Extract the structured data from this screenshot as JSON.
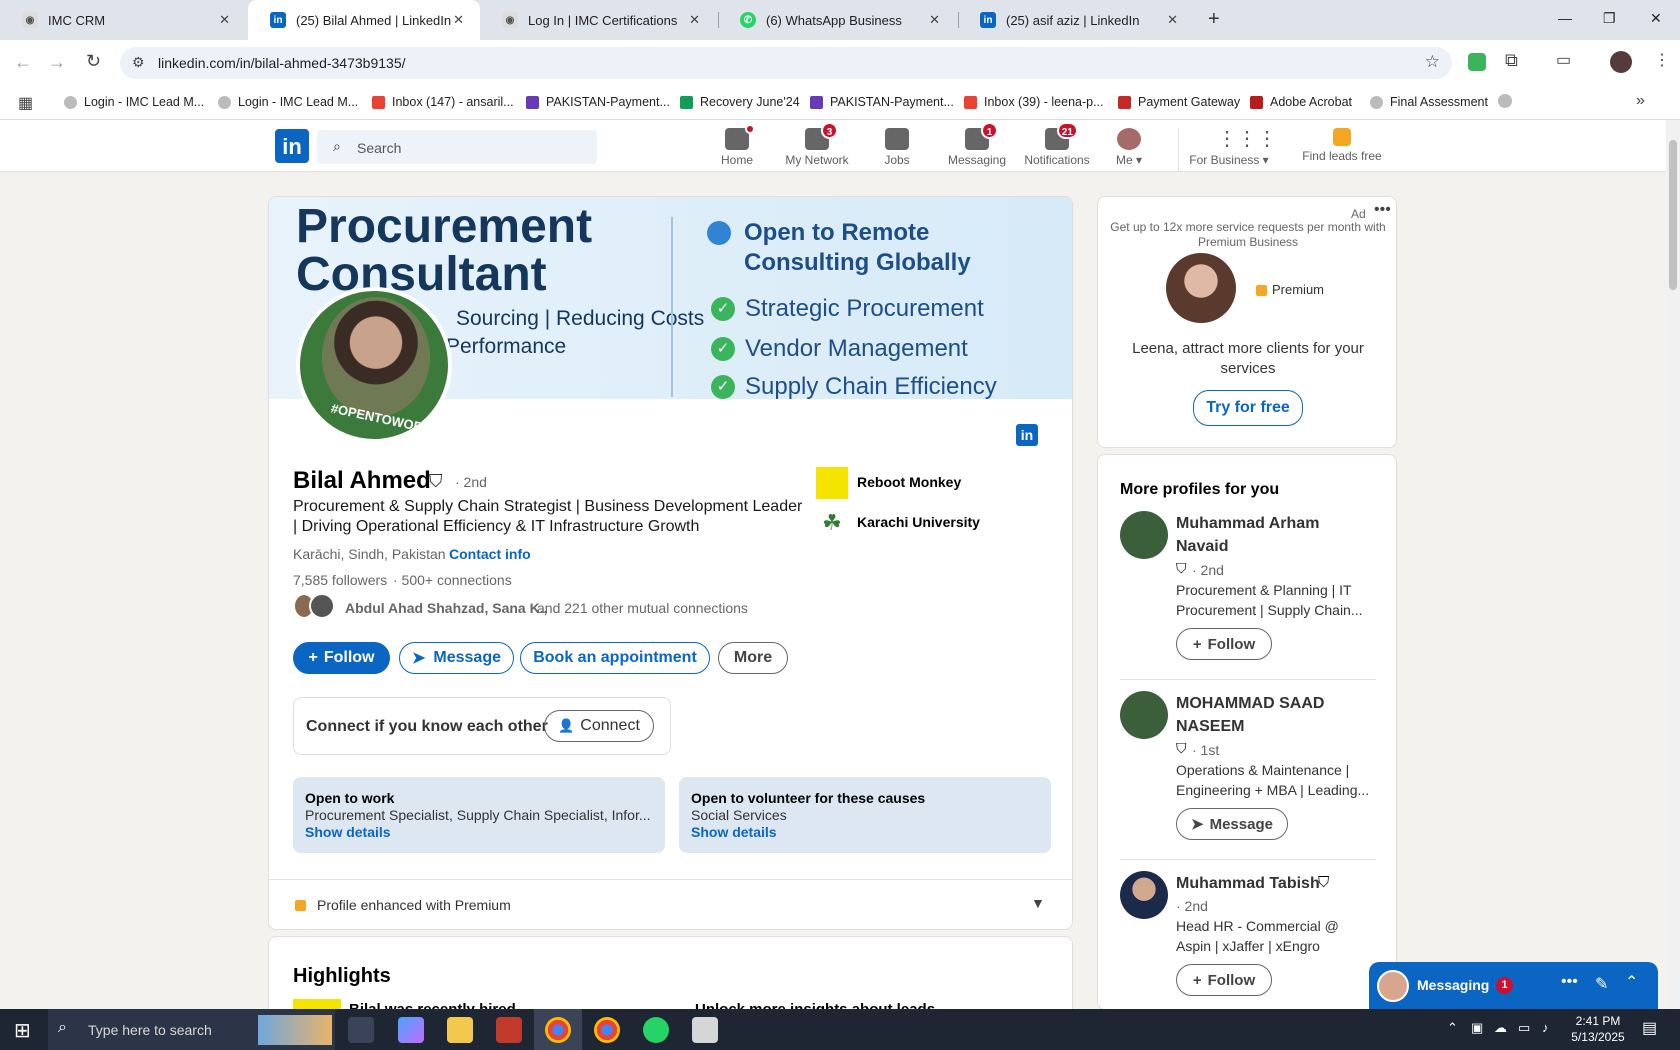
{
  "browser": {
    "tabs": [
      {
        "title": "IMC CRM",
        "icon": "imc-icon"
      },
      {
        "title": "(25) Bilal Ahmed | LinkedIn",
        "icon": "linkedin-icon"
      },
      {
        "title": "Log In | IMC Certifications",
        "icon": "imc-icon"
      },
      {
        "title": "(6) WhatsApp Business",
        "icon": "whatsapp-icon"
      },
      {
        "title": "(25) asif aziz | LinkedIn",
        "icon": "linkedin-icon"
      }
    ],
    "url": "linkedin.com/in/bilal-ahmed-3473b9135/",
    "bookmarks": [
      "Login - IMC Lead M...",
      "Login - IMC Lead M...",
      "Inbox (147) - ansaril...",
      "PAKISTAN-Payment...",
      "Recovery June'24",
      "PAKISTAN-Payment...",
      "Inbox (39) - leena-p...",
      "Payment Gateway",
      "Adobe Acrobat",
      "Final Assessment"
    ]
  },
  "linkedin_nav": {
    "search_placeholder": "Search",
    "items": [
      {
        "label": "Home",
        "badge": ""
      },
      {
        "label": "My Network",
        "badge": "3"
      },
      {
        "label": "Jobs",
        "badge": ""
      },
      {
        "label": "Messaging",
        "badge": "1"
      },
      {
        "label": "Notifications",
        "badge": "21"
      },
      {
        "label": "Me",
        "badge": ""
      },
      {
        "label": "For Business",
        "badge": ""
      },
      {
        "label": "Find leads free",
        "badge": ""
      }
    ]
  },
  "banner": {
    "title_line1": "Procurement",
    "title_line2": "Consultant",
    "sub_line1": "Sourcing | Reducing Costs",
    "sub_line2": "Performance",
    "right_head1": "Open to Remote",
    "right_head2": "Consulting Globally",
    "checks": [
      "Strategic Procurement",
      "Vendor Management",
      "Supply Chain Efficiency"
    ],
    "opentowork": "#OPENTOWORK"
  },
  "profile": {
    "name": "Bilal Ahmed",
    "degree": "· 2nd",
    "headline1": "Procurement & Supply Chain Strategist | Business Development Leader",
    "headline2": "| Driving Operational Efficiency & IT Infrastructure Growth",
    "location": "Karāchi, Sindh, Pakistan ·",
    "contact": "Contact info",
    "followers": "7,585 followers",
    "connections": "· 500+ connections",
    "mutual_names": "Abdul Ahad Shahzad, Sana K.,",
    "mutual_rest": "and 221 other mutual connections",
    "company": "Reboot Monkey",
    "school": "Karachi University",
    "follow": "Follow",
    "message": "Message",
    "book": "Book an appointment",
    "more": "More",
    "connect_text": "Connect if you know each other",
    "connect_btn": "Connect",
    "open_work_title": "Open to work",
    "open_work_desc": "Procurement Specialist, Supply Chain Specialist, Infor...",
    "open_work_link": "Show details",
    "volunteer_title": "Open to volunteer for these causes",
    "volunteer_desc": "Social Services",
    "volunteer_link": "Show details",
    "premium_text": "Profile enhanced with Premium",
    "highlights_title": "Highlights",
    "highlight1": "Bilal was recently hired",
    "highlight2": "Unlock more insights about leads"
  },
  "ad": {
    "label": "Ad",
    "text": "Get up to 12x more service requests per month with Premium Business",
    "premium": "Premium",
    "pitch": "Leena, attract more clients for your services",
    "cta": "Try for free"
  },
  "more_profiles": {
    "title": "More profiles for you",
    "people": [
      {
        "name1": "Muhammad Arham",
        "name2": "Navaid",
        "degree": "· 2nd",
        "desc1": "Procurement & Planning | IT",
        "desc2": "Procurement | Supply Chain...",
        "button": "Follow"
      },
      {
        "name1": "MOHAMMAD SAAD",
        "name2": "NASEEM",
        "degree": "· 1st",
        "desc1": "Operations & Maintenance |",
        "desc2": "Engineering + MBA | Leading...",
        "button": "Message"
      },
      {
        "name1": "Muhammad Tabish",
        "name2": "",
        "degree": "· 2nd",
        "desc1": "Head HR - Commercial @",
        "desc2": "Aspin | xJaffer | xEngro",
        "button": "Follow"
      }
    ]
  },
  "messaging": {
    "label": "Messaging",
    "count": "1"
  },
  "taskbar": {
    "search": "Type here to search",
    "time": "2:41 PM",
    "date": "5/13/2025"
  },
  "colors": {
    "linkedin_blue": "#0a66c2",
    "badge_red": "#cb112d",
    "green_check": "#3bb55b"
  }
}
